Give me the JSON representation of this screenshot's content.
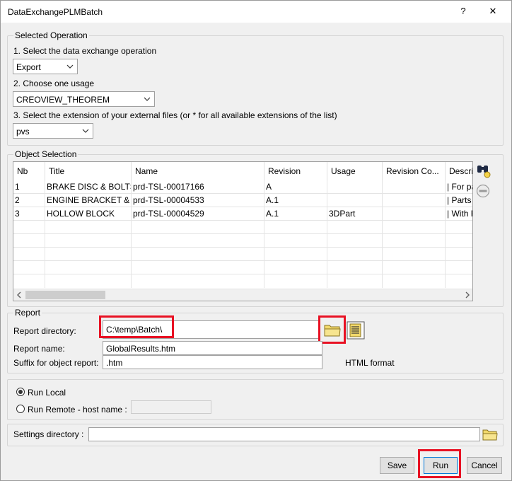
{
  "window": {
    "title": "DataExchangePLMBatch",
    "help_glyph": "?",
    "close_glyph": "✕"
  },
  "selected_operation": {
    "legend": "Selected Operation",
    "step1_label": "1. Select the data exchange operation",
    "operation_value": "Export",
    "step2_label": "2. Choose one usage",
    "usage_value": "CREOVIEW_THEOREM",
    "step3_label": "3. Select the extension of your external files (or * for all available extensions of the list)",
    "extension_value": "pvs"
  },
  "object_selection": {
    "legend": "Object Selection",
    "columns": [
      "Nb",
      "Title",
      "Name",
      "Revision",
      "Usage",
      "Revision Co...",
      "Descri"
    ],
    "rows": [
      [
        "1",
        "BRAKE DISC & BOLTS",
        "prd-TSL-00017166",
        "A",
        "",
        "",
        "| For pa"
      ],
      [
        "2",
        "ENGINE BRACKET & ...",
        "prd-TSL-00004533",
        "A.1",
        "",
        "",
        "| Parts v"
      ],
      [
        "3",
        "HOLLOW BLOCK",
        "prd-TSL-00004529",
        "A.1",
        "3DPart",
        "",
        "| With F"
      ]
    ]
  },
  "report": {
    "legend": "Report",
    "directory_label": "Report directory:",
    "directory_value": "C:\\temp\\Batch\\",
    "name_label": "Report name:",
    "name_value": "GlobalResults.htm",
    "suffix_label": "Suffix for object report:",
    "suffix_value": ".htm",
    "format_text": "HTML format"
  },
  "run_mode": {
    "local_label": "Run Local",
    "local_selected": true,
    "remote_label": "Run Remote - host name :",
    "remote_host_value": ""
  },
  "settings": {
    "directory_label": "Settings directory :",
    "directory_value": ""
  },
  "buttons": {
    "save": "Save",
    "run": "Run",
    "cancel": "Cancel"
  },
  "icons": {
    "search": "binoculars-icon",
    "remove": "remove-icon",
    "folder": "folder-icon",
    "report_view": "report-view-icon"
  },
  "colors": {
    "highlight": "#e81123",
    "folder": "#f2d96b"
  }
}
